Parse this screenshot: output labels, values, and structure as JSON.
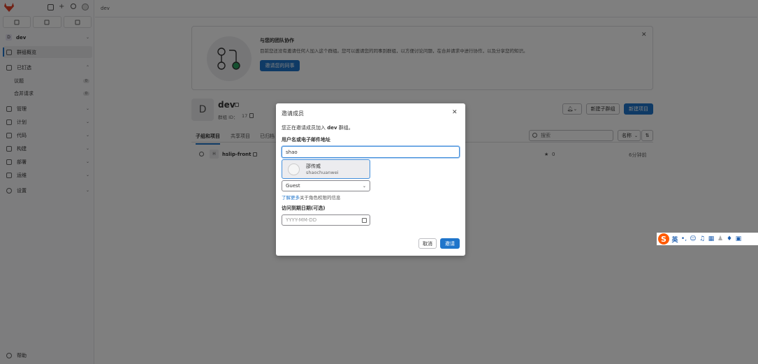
{
  "sidebar": {
    "group_name": "dev",
    "items": [
      {
        "label": "群组概览"
      },
      {
        "label": "已钉选"
      },
      {
        "label": "议题",
        "count": "0"
      },
      {
        "label": "合并请求",
        "count": "0"
      },
      {
        "label": "管理"
      },
      {
        "label": "计划"
      },
      {
        "label": "代码"
      },
      {
        "label": "构建"
      },
      {
        "label": "部署"
      },
      {
        "label": "运维"
      },
      {
        "label": "设置"
      }
    ],
    "help_label": "帮助"
  },
  "breadcrumb": "dev",
  "banner": {
    "title": "与您的团队协作",
    "text": "目前您还没有邀请任何人加入这个群组。您可以邀请您的同事到群组，以方便讨论问题，在合并请求中进行协作，以及分享您的知识。",
    "button": "邀请您的同事"
  },
  "group": {
    "avatar_letter": "D",
    "name": "dev",
    "id_label": "群组 ID：",
    "id_value": "17",
    "new_subgroup": "新建子群组",
    "new_project": "新建项目"
  },
  "tabs": [
    "子组和项目",
    "共享项目",
    "已归档"
  ],
  "search": {
    "placeholder": "搜索"
  },
  "sort": {
    "label": "名称"
  },
  "projects": [
    {
      "avatar": "H",
      "name": "hslip-front",
      "stars": "0",
      "updated": "6分钟前"
    }
  ],
  "modal": {
    "title": "邀请成员",
    "description_prefix": "您正在邀请成员加入 ",
    "description_group": "dev",
    "description_suffix": " 群组。",
    "field_label": "用户名或电子邮件地址",
    "field_value": "shao",
    "suggestion_name": "邵传威",
    "suggestion_username": "shaochuanwei",
    "role_value": "Guest",
    "learn_more_link": "了解更多",
    "learn_more_rest": "关于角色权限的信息",
    "expiry_label": "访问到期日期(可选)",
    "date_placeholder": "YYYY-MM-DD",
    "cancel": "取消",
    "invite": "邀请"
  },
  "ime": {
    "mode": "英",
    "colors": {
      "brand": "#ff5a00",
      "icons": "#1f5fb0"
    }
  }
}
